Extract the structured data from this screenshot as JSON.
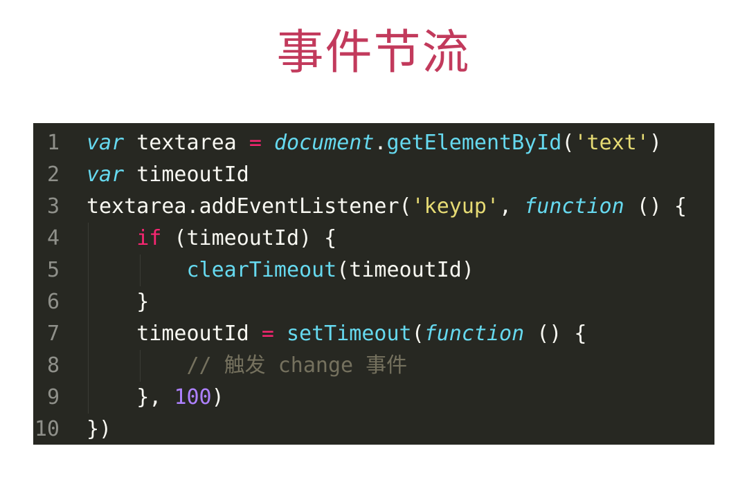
{
  "title": "事件节流",
  "code": {
    "lines": [
      {
        "n": "1",
        "tokens": [
          [
            "kw",
            "var"
          ],
          [
            "pl",
            " textarea "
          ],
          [
            "op",
            "="
          ],
          [
            "pl",
            " "
          ],
          [
            "it",
            "document"
          ],
          [
            "pl",
            "."
          ],
          [
            "fn",
            "getElementById"
          ],
          [
            "pl",
            "("
          ],
          [
            "str",
            "'text'"
          ],
          [
            "pl",
            ")"
          ]
        ]
      },
      {
        "n": "2",
        "tokens": [
          [
            "kw",
            "var"
          ],
          [
            "pl",
            " timeoutId"
          ]
        ]
      },
      {
        "n": "3",
        "tokens": [
          [
            "pl",
            "textarea.addEventListener("
          ],
          [
            "str",
            "'keyup'"
          ],
          [
            "pl",
            ", "
          ],
          [
            "it",
            "function"
          ],
          [
            "pl",
            " () {"
          ]
        ]
      },
      {
        "n": "4",
        "tokens": [
          [
            "pl",
            "    "
          ],
          [
            "op",
            "if"
          ],
          [
            "pl",
            " (timeoutId) {"
          ]
        ]
      },
      {
        "n": "5",
        "tokens": [
          [
            "pl",
            "        "
          ],
          [
            "fn",
            "clearTimeout"
          ],
          [
            "pl",
            "(timeoutId)"
          ]
        ]
      },
      {
        "n": "6",
        "tokens": [
          [
            "pl",
            "    }"
          ]
        ]
      },
      {
        "n": "7",
        "tokens": [
          [
            "pl",
            "    timeoutId "
          ],
          [
            "op",
            "="
          ],
          [
            "pl",
            " "
          ],
          [
            "fn",
            "setTimeout"
          ],
          [
            "pl",
            "("
          ],
          [
            "it",
            "function"
          ],
          [
            "pl",
            " () {"
          ]
        ]
      },
      {
        "n": "8",
        "tokens": [
          [
            "pl",
            "        "
          ],
          [
            "cm",
            "// 触发 change 事件"
          ]
        ]
      },
      {
        "n": "9",
        "tokens": [
          [
            "pl",
            "    }, "
          ],
          [
            "num",
            "100"
          ],
          [
            "pl",
            ")"
          ]
        ]
      },
      {
        "n": "10",
        "tokens": [
          [
            "pl",
            "})"
          ]
        ]
      }
    ]
  }
}
